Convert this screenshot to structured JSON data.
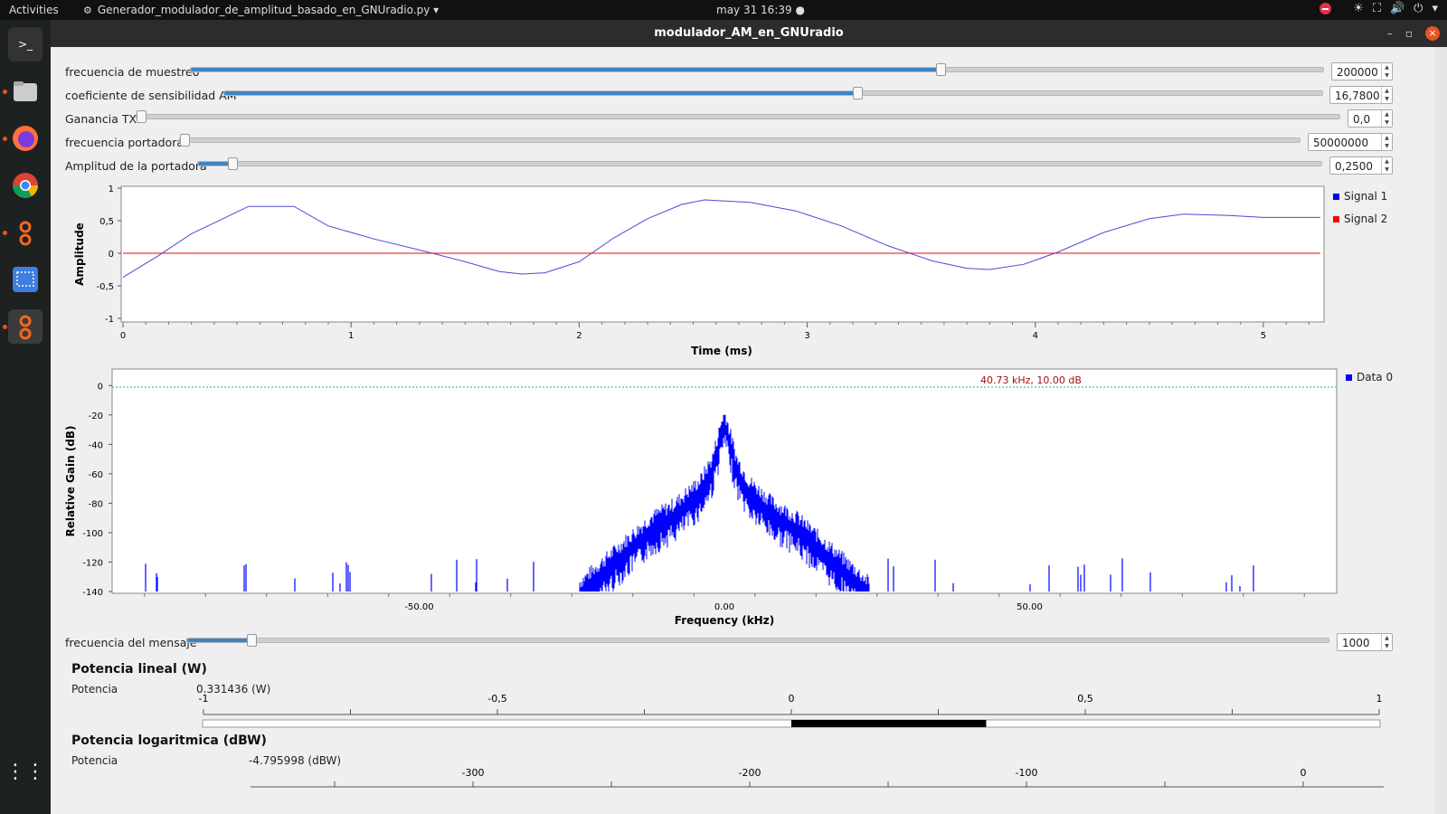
{
  "topbar": {
    "activities": "Activities",
    "app_name": "Generador_modulador_de_amplitud_basado_en_GNUradio.py",
    "clock": "may 31  16:39"
  },
  "window": {
    "title": "modulador_AM_en_GNUradio"
  },
  "controls": [
    {
      "label": "frecuencia de muestreo",
      "value": "200000",
      "fraction": 0.66
    },
    {
      "label": "coeficiente de sensibilidad AM",
      "value": "16,7800",
      "fraction": 0.575
    },
    {
      "label": "Ganancia TX",
      "value": "0,0",
      "fraction": 0.0
    },
    {
      "label": "frecuencia portadora",
      "value": "50000000",
      "fraction": 0.0
    },
    {
      "label": "Amplitud de la portadora",
      "value": "0,2500",
      "fraction": 0.03
    }
  ],
  "message_control": {
    "label": "frecuencia del mensaje",
    "value": "1000",
    "fraction": 0.055
  },
  "time_plot": {
    "xlabel": "Time (ms)",
    "ylabel": "Amplitude",
    "xticks": [
      "0",
      "1",
      "2",
      "3",
      "4",
      "5"
    ],
    "yticks": [
      "1",
      "0,5",
      "0",
      "-0,5",
      "-1"
    ],
    "legend": [
      {
        "name": "Signal 1",
        "color": "#0000ff"
      },
      {
        "name": "Signal 2",
        "color": "#ff0000"
      }
    ]
  },
  "freq_plot": {
    "xlabel": "Frequency (kHz)",
    "ylabel": "Relative Gain (dB)",
    "xticks": [
      "-50.00",
      "0.00",
      "50.00"
    ],
    "yticks": [
      "0",
      "-20",
      "-40",
      "-60",
      "-80",
      "-100",
      "-120",
      "-140"
    ],
    "marker": "40.73 kHz, 10.00 dB",
    "legend": [
      {
        "name": "Data 0",
        "color": "#0000ff"
      }
    ]
  },
  "linear_power": {
    "title": "Potencia lineal (W)",
    "label": "Potencia",
    "value": "0.331436 (W)",
    "ticks": [
      "-1",
      "-0,5",
      "0",
      "0,5",
      "1"
    ],
    "level": 0.331436
  },
  "log_power": {
    "title": "Potencia logaritmica (dBW)",
    "label": "Potencia",
    "value": "-4.795998 (dBW)",
    "ticks": [
      "-300",
      "-200",
      "-100",
      "0"
    ]
  },
  "chart_data": [
    {
      "type": "line",
      "title": "",
      "xlabel": "Time (ms)",
      "ylabel": "Amplitude",
      "xlim": [
        0,
        5.25
      ],
      "ylim": [
        -1,
        1
      ],
      "series": [
        {
          "name": "Signal 1",
          "color": "#4a4ad8",
          "x": [
            0,
            0.15,
            0.3,
            0.45,
            0.55,
            0.75,
            0.9,
            1.1,
            1.3,
            1.5,
            1.65,
            1.75,
            1.85,
            2.0,
            2.15,
            2.3,
            2.45,
            2.55,
            2.75,
            2.95,
            3.15,
            3.35,
            3.55,
            3.7,
            3.8,
            3.95,
            4.1,
            4.3,
            4.5,
            4.65,
            4.85,
            5.0,
            5.25
          ],
          "y": [
            -0.37,
            -0.05,
            0.3,
            0.55,
            0.72,
            0.72,
            0.42,
            0.22,
            0.05,
            -0.13,
            -0.28,
            -0.32,
            -0.3,
            -0.13,
            0.23,
            0.53,
            0.75,
            0.82,
            0.78,
            0.65,
            0.42,
            0.12,
            -0.12,
            -0.23,
            -0.25,
            -0.17,
            0.02,
            0.32,
            0.53,
            0.6,
            0.58,
            0.55,
            0.55
          ]
        },
        {
          "name": "Signal 2",
          "color": "#ff0000",
          "x": [
            0,
            5.25
          ],
          "y": [
            0,
            0
          ]
        }
      ]
    },
    {
      "type": "line",
      "title": "",
      "xlabel": "Frequency (kHz)",
      "ylabel": "Relative Gain (dB)",
      "xlim": [
        -100,
        100
      ],
      "ylim": [
        -140,
        10
      ],
      "series": [
        {
          "name": "Data 0",
          "color": "#0000ff",
          "x": [
            -24,
            -20,
            -16,
            -12,
            -8,
            -4,
            -2,
            0,
            2,
            4,
            8,
            12,
            16,
            20,
            24
          ],
          "y": [
            -140,
            -125,
            -110,
            -95,
            -85,
            -70,
            -55,
            -22,
            -55,
            -70,
            -85,
            -95,
            -110,
            -125,
            -140
          ]
        }
      ]
    }
  ]
}
